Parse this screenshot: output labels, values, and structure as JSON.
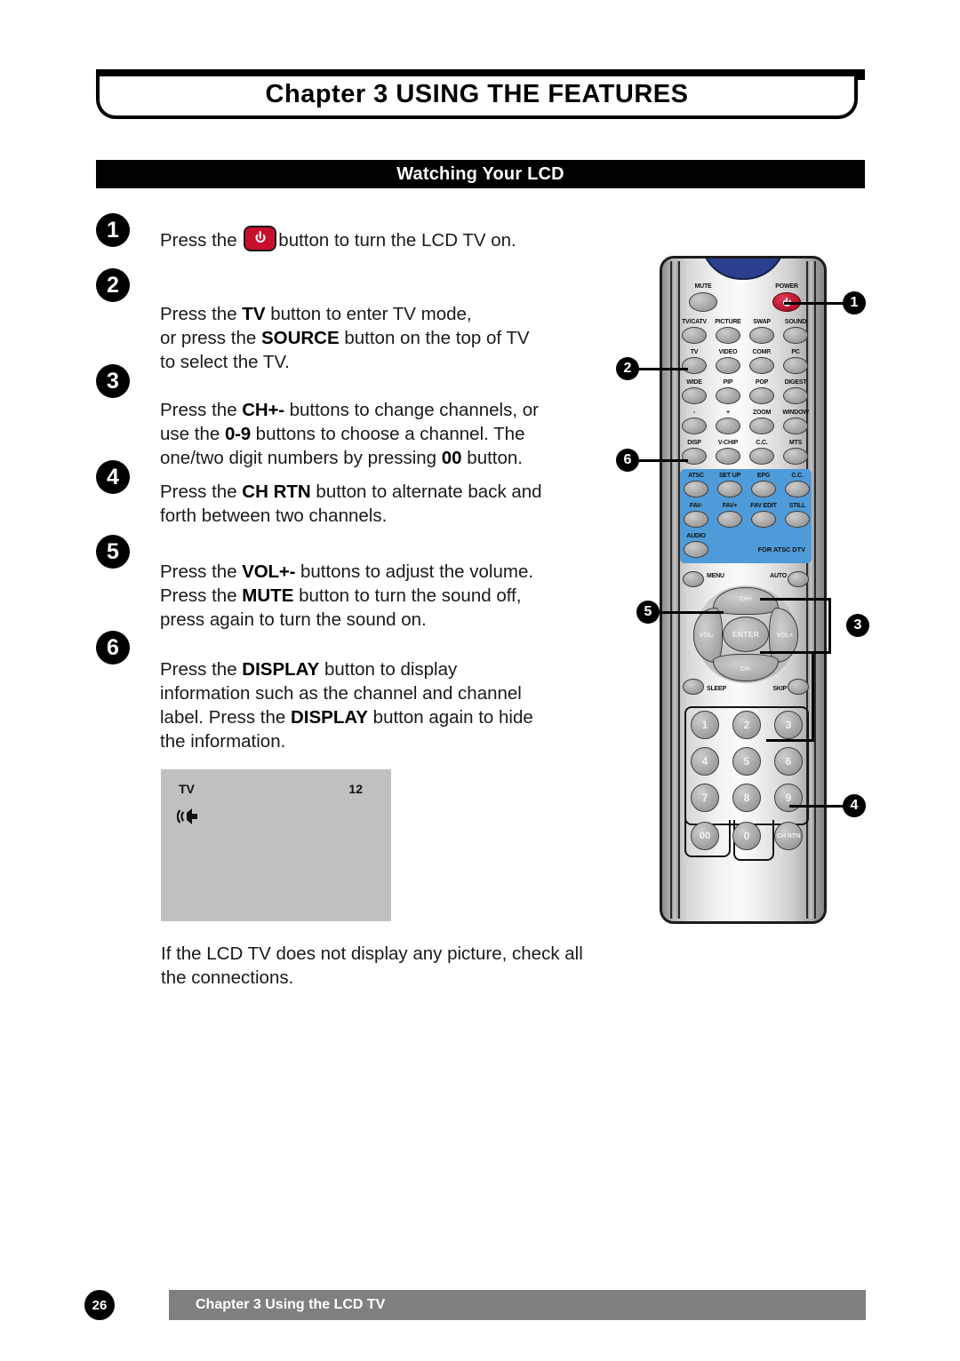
{
  "header": {
    "title": "Chapter 3 USING THE FEATURES"
  },
  "section": {
    "title": "Watching Your LCD"
  },
  "steps": [
    {
      "number": "1",
      "text_before": "Press the ",
      "icon": "power-icon",
      "text_after": "button to turn the LCD TV on."
    },
    {
      "number": "2",
      "lines": [
        "Press the TV button to enter TV mode,",
        "or press the SOURCE button on the top of TV",
        "to select the TV."
      ]
    },
    {
      "number": "3",
      "lines": [
        "Press the CH+- buttons to change channels, or",
        "use the 0-9 buttons to choose a channel. The",
        "one/two digit numbers by pressing 00 button."
      ]
    },
    {
      "number": "4",
      "lines": [
        "Press the CH RTN button to alternate back and",
        "forth between two channels."
      ]
    },
    {
      "number": "5",
      "lines": [
        "Press the VOL+- buttons to adjust the volume.",
        "Press the MUTE button to turn the sound off,",
        "press again to turn the sound on."
      ]
    },
    {
      "number": "6",
      "lines": [
        "Press the DISPLAY button to display",
        "information such as the channel and channel",
        "label. Press the DISPLAY button again to hide",
        "the information."
      ]
    }
  ],
  "tv_sample": {
    "source_label": "TV",
    "channel_number": "12",
    "icon": "speaker-icon",
    "background_color": "#c0c0c0"
  },
  "note": "If the LCD TV does not display any picture, check all the connections.",
  "remote": {
    "power_button": {
      "label": "POWER",
      "color": "#b3102c",
      "icon": "power-icon"
    },
    "mute_button": {
      "label": "MUTE"
    },
    "row_source": [
      "TV/CATV",
      "PICTURE",
      "SWAP",
      "SOUND"
    ],
    "row_input": [
      "TV",
      "VIDEO",
      "COMP.",
      "PC"
    ],
    "row_wide": [
      "WIDE",
      "PIP",
      "POP",
      "DIGEST"
    ],
    "row_zoom": [
      "-",
      "+",
      "ZOOM",
      "WINDOW"
    ],
    "row_disp": [
      "DISP",
      "V-CHIP",
      "C.C.",
      "MTS"
    ],
    "atsc_panel": {
      "color": "#4f9bd9",
      "row1": [
        "ATSC",
        "SET UP",
        "EPG",
        "C.C."
      ],
      "row2": [
        "FAV-",
        "FAV+",
        "FAV EDIT",
        "STILL"
      ],
      "row3": [
        "AUDIO"
      ],
      "note": "FOR ATSC DTV"
    },
    "menu_button": "MENU",
    "auto_button": "AUTO",
    "dpad": {
      "up": "CH+",
      "down": "CH-",
      "left": "VOL-",
      "right": "VOL+",
      "center": "ENTER"
    },
    "sleep_button": "SLEEP",
    "skip_button": "SKIP",
    "keypad": [
      "1",
      "2",
      "3",
      "4",
      "5",
      "6",
      "7",
      "8",
      "9"
    ],
    "key_double_zero": "00",
    "key_zero": "0",
    "key_ch_rtn": "CH RTN"
  },
  "callouts": [
    {
      "number": "1",
      "target": "power-button"
    },
    {
      "number": "2",
      "target": "tv-button"
    },
    {
      "number": "3",
      "target": "ch-updown-and-keypad"
    },
    {
      "number": "4",
      "target": "ch-rtn-button"
    },
    {
      "number": "5",
      "target": "vol-buttons"
    },
    {
      "number": "6",
      "target": "disp-button"
    }
  ],
  "footer": {
    "page_number": "26",
    "text": "Chapter 3 Using the LCD TV",
    "bar_color": "#808080"
  }
}
